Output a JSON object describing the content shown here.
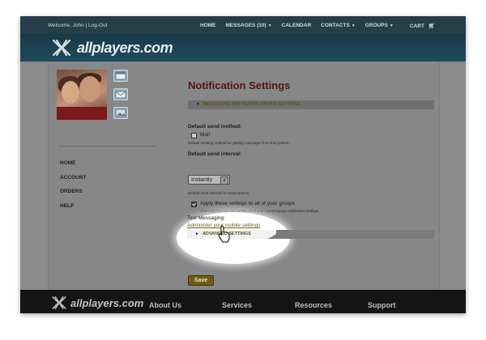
{
  "topbar": {
    "welcome": "Welcome, John",
    "logout": "Log-Out",
    "nav": [
      {
        "label": "HOME",
        "dropdown": false
      },
      {
        "label": "MESSAGES (10)",
        "dropdown": true
      },
      {
        "label": "CALENDAR",
        "dropdown": false
      },
      {
        "label": "CONTACTS",
        "dropdown": true
      },
      {
        "label": "GROUPS",
        "dropdown": true
      },
      {
        "label": "CART",
        "dropdown": false
      }
    ]
  },
  "brand": {
    "name": "allplayers.com"
  },
  "sidebar": {
    "icons": [
      "calendar-icon",
      "mail-icon",
      "photo-icon"
    ],
    "menu": [
      "HOME",
      "ACCOUNT",
      "ORDERS",
      "HELP"
    ]
  },
  "main": {
    "title": "Notification Settings",
    "section_header": "MESSAGING AND NOTIFICATIONS SETTINGS",
    "default_send_method": {
      "label": "Default send method:",
      "option": "Mail",
      "option_checked": false,
      "description": "Default sending method for getting messages from this system."
    },
    "default_send_interval": {
      "label": "Default send interval:",
      "value": "Instantly",
      "description": "Default send interval for subscriptions."
    },
    "apply_all": {
      "label": "Apply these settings to all of your groups",
      "checked": true,
      "description": "Checking this box will update all of your current group notification settings."
    },
    "text_messaging": {
      "label": "Text Messaging:",
      "link": "Administer your mobile settings"
    },
    "advanced_header": "ADVANCED SETTINGS",
    "save_label": "Save"
  },
  "footer": {
    "brand": "allplayers.com",
    "columns": [
      "About Us",
      "Services",
      "Resources",
      "Support"
    ]
  },
  "colors": {
    "topbar": "#243e4a",
    "title": "#531616",
    "accent_gold": "#6d5c15"
  }
}
